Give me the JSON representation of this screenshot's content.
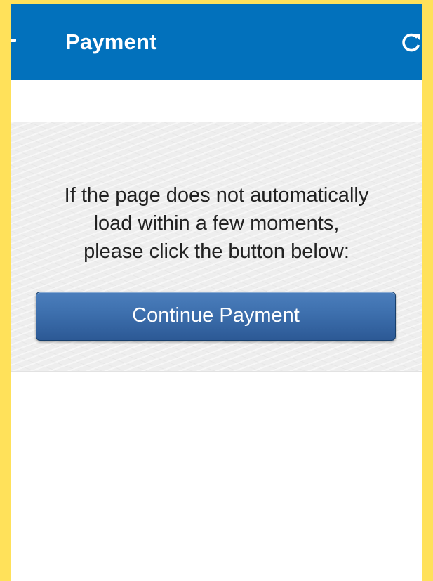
{
  "app_bar": {
    "title": "Payment",
    "back_icon": "arrow-back-icon",
    "refresh_icon": "refresh-icon",
    "color": "#0271BC"
  },
  "content": {
    "message_lines": [
      "If the page does not automatically",
      "load within a few moments,",
      "please click the button below:"
    ],
    "continue_button_label": "Continue Payment",
    "button_color": "#3D6FAD"
  },
  "frame_color": "#FFE15A"
}
